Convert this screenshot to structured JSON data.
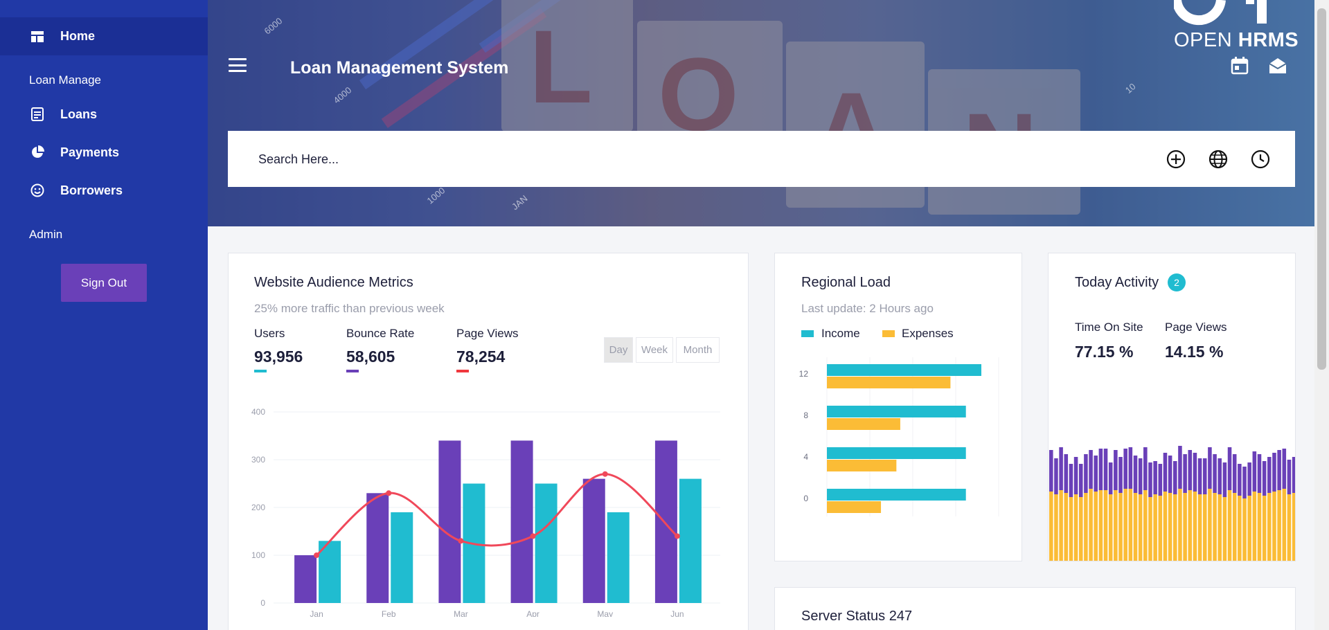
{
  "sidebar": {
    "home": "Home",
    "section_loan": "Loan Manage",
    "items": [
      {
        "label": "Loans",
        "icon": "document-list-icon"
      },
      {
        "label": "Payments",
        "icon": "pie-chart-icon"
      },
      {
        "label": "Borrowers",
        "icon": "smiley-icon"
      }
    ],
    "section_admin": "Admin",
    "signout": "Sign Out"
  },
  "header": {
    "title": "Loan Management System",
    "logo_open": "OPEN",
    "logo_hrms": "HRMS",
    "banner_letters": [
      "L",
      "O",
      "A",
      "N"
    ],
    "banner_numbers": [
      "6000",
      "4000",
      "1000",
      "10",
      "JAN"
    ]
  },
  "search": {
    "placeholder": "Search Here..."
  },
  "audience": {
    "title": "Website Audience Metrics",
    "subtitle": "25% more traffic than previous week",
    "metrics": [
      {
        "label": "Users",
        "value": "93,956",
        "color": "#20bcd0"
      },
      {
        "label": "Bounce Rate",
        "value": "58,605",
        "color": "#6a40b8"
      },
      {
        "label": "Page Views",
        "value": "78,254",
        "color": "#f0383e"
      }
    ],
    "ranges": [
      "Day",
      "Week",
      "Month"
    ]
  },
  "regional": {
    "title": "Regional Load",
    "subtitle": "Last update: 2 Hours ago",
    "legend": [
      {
        "label": "Income",
        "color": "#20bcd0"
      },
      {
        "label": "Expenses",
        "color": "#fbbc36"
      }
    ]
  },
  "activity": {
    "title": "Today Activity",
    "badge": "2",
    "stats": [
      {
        "label": "Time On Site",
        "value": "77.15 %"
      },
      {
        "label": "Page Views",
        "value": "14.15 %"
      }
    ]
  },
  "server": {
    "title": "Server Status 247"
  },
  "chart_data": [
    {
      "type": "bar",
      "categories": [
        "Jan",
        "Feb",
        "Mar",
        "Apr",
        "May",
        "Jun"
      ],
      "series": [
        {
          "name": "",
          "values": [
            100,
            230,
            340,
            340,
            260,
            340
          ],
          "color": "#6a40b8"
        },
        {
          "name": "",
          "values": [
            130,
            190,
            250,
            250,
            190,
            260
          ],
          "color": "#20bcd0"
        },
        {
          "name": "",
          "type": "line",
          "values": [
            100,
            230,
            130,
            140,
            270,
            140
          ],
          "color": "#f0485a"
        }
      ],
      "ylim": [
        0,
        400
      ],
      "yticks": [
        0,
        100,
        200,
        300,
        400
      ],
      "grid": true
    },
    {
      "type": "bar",
      "orientation": "horizontal",
      "categories": [
        "12",
        "8",
        "4",
        "0"
      ],
      "series": [
        {
          "name": "Income",
          "values": [
            20,
            18,
            18,
            18
          ]
        },
        {
          "name": "Expenses",
          "values": [
            16,
            9.5,
            9,
            7
          ]
        }
      ],
      "xlim": [
        0,
        20
      ]
    },
    {
      "type": "bar",
      "stacked": true,
      "series": [
        {
          "name": "",
          "color": "#6a40b8",
          "values": [
            60,
            52,
            62,
            56,
            48,
            54,
            48,
            56,
            56,
            52,
            60,
            60,
            46,
            58,
            52,
            58,
            60,
            54,
            52,
            62,
            50,
            48,
            46,
            56,
            54,
            48,
            62,
            56,
            58,
            56,
            52,
            52,
            60,
            56,
            52,
            50,
            62,
            56,
            46,
            46,
            48,
            58,
            56,
            50,
            52,
            56,
            58,
            58,
            50,
            52
          ]
        },
        {
          "name": "",
          "color": "#fbbc36",
          "values": [
            100,
            96,
            102,
            98,
            92,
            96,
            92,
            98,
            104,
            100,
            102,
            102,
            96,
            102,
            98,
            104,
            104,
            98,
            96,
            102,
            92,
            96,
            94,
            100,
            98,
            96,
            104,
            98,
            102,
            100,
            96,
            96,
            104,
            98,
            96,
            92,
            102,
            98,
            94,
            90,
            94,
            100,
            98,
            94,
            98,
            100,
            102,
            104,
            96,
            98
          ]
        }
      ]
    }
  ]
}
